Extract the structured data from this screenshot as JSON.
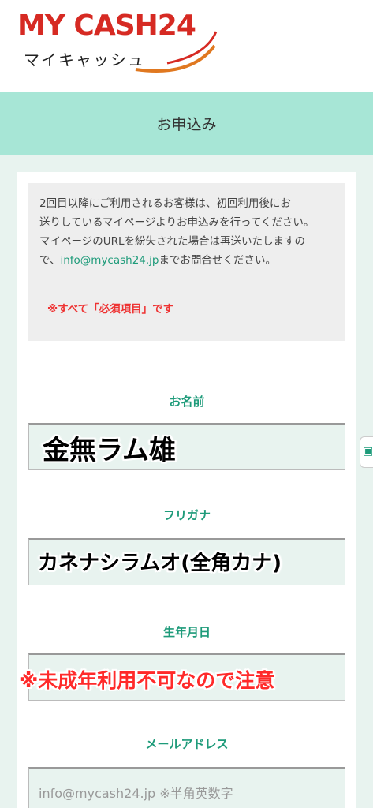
{
  "logo": {
    "main": "MY CASH24",
    "sub": "マイキャッシュ"
  },
  "page_title": "お申込み",
  "notice": {
    "line1": "2回目以降にご利用されるお客様は、初回利用後にお",
    "line2": "送りしているマイページよりお申込みを行ってください。",
    "line3": "マイページのURLを紛失された場合は再送いたしますの",
    "line4_pre": "で、",
    "line4_link": "info@mycash24.jp",
    "line4_post": "までお問合せください。",
    "required": "※すべて「必須項目」です"
  },
  "fields": {
    "name": {
      "label": "お名前",
      "value": "金無ラム雄"
    },
    "kana": {
      "label": "フリガナ",
      "value": "カネナシラムオ(全角カナ)"
    },
    "birth": {
      "label": "生年月日",
      "value": "※未成年利用不可なので注意"
    },
    "email": {
      "label": "メールアドレス",
      "placeholder": "info@mycash24.jp ※半角英数字"
    }
  },
  "side_tab": {
    "icon": "chat-icon"
  },
  "colors": {
    "accent": "#1e9b7a",
    "title_bar": "#a7e6d6",
    "brand_red": "#d62a23",
    "warning": "#ff2a2a"
  }
}
